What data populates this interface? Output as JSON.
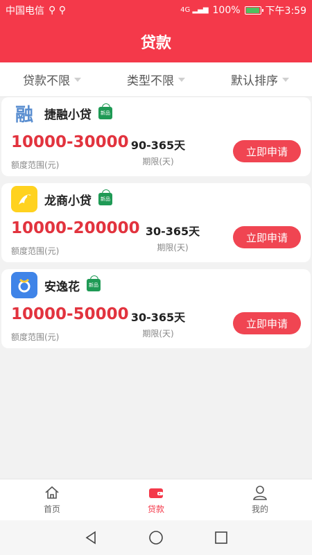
{
  "status": {
    "carrier": "中国电信",
    "battery": "100%",
    "time": "下午3:59",
    "battery_level": 1.0,
    "signal": "4G"
  },
  "header": {
    "title": "贷款"
  },
  "filters": [
    {
      "label": "贷款不限"
    },
    {
      "label": "类型不限"
    },
    {
      "label": "默认排序"
    }
  ],
  "cards": [
    {
      "name": "捷融小贷",
      "tag": "新品",
      "amount": "10000-30000",
      "amount_label": "额度范围(元)",
      "term": "90-365天",
      "term_label": "期限(天)",
      "button": "立即申请",
      "logo_text": "融"
    },
    {
      "name": "龙商小贷",
      "tag": "新品",
      "amount": "10000-200000",
      "amount_label": "额度范围(元)",
      "term": "30-365天",
      "term_label": "期限(天)",
      "button": "立即申请"
    },
    {
      "name": "安逸花",
      "tag": "新品",
      "amount": "10000-50000",
      "amount_label": "额度范围(元)",
      "term": "30-365天",
      "term_label": "期限(天)",
      "button": "立即申请"
    }
  ],
  "tabs": [
    {
      "label": "首页"
    },
    {
      "label": "贷款"
    },
    {
      "label": "我的"
    }
  ],
  "colors": {
    "brand": "#f4394a",
    "amount": "#e2333e",
    "tag": "#1f9a55"
  }
}
